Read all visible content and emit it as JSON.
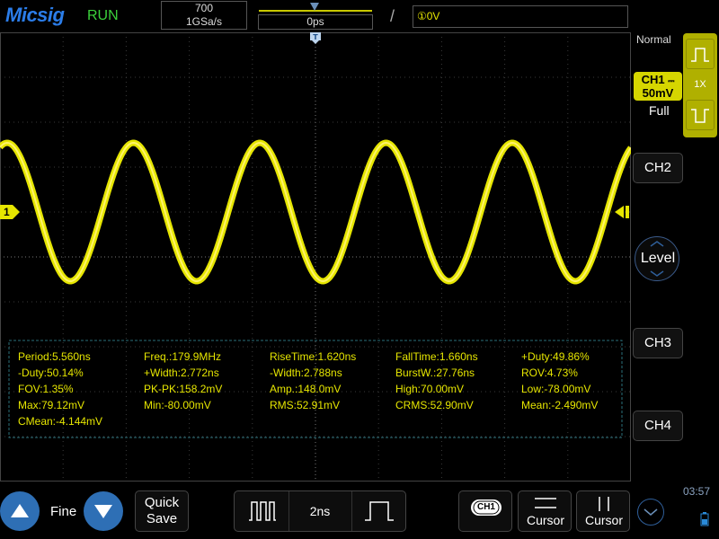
{
  "brand": {
    "logo": "Micsig",
    "run_state": "RUN"
  },
  "acquisition": {
    "memory_depth": "700",
    "sample_rate": "1GSa/s"
  },
  "timebase": {
    "offset": "0ps",
    "scale": "2ns"
  },
  "trigger": {
    "slope_symbol": "/",
    "source_level": "①0V"
  },
  "right_panel": {
    "trigger_mode": "Normal",
    "ch1_label": "CH1",
    "ch1_coupling_symbol": "⎓",
    "ch1_scale": "50mV",
    "ch1_probe": "1X",
    "bandwidth": "Full",
    "ch2": "CH2",
    "level": "Level",
    "ch3": "CH3",
    "ch4": "CH4"
  },
  "markers": {
    "ch1_ground": "1"
  },
  "measurements": [
    [
      "Period:5.560ns",
      "Freq.:179.9MHz",
      "RiseTime:1.620ns",
      "FallTime:1.660ns",
      "+Duty:49.86%"
    ],
    [
      "-Duty:50.14%",
      "+Width:2.772ns",
      "-Width:2.788ns",
      "BurstW.:27.76ns",
      "ROV:4.73%"
    ],
    [
      "FOV:1.35%",
      "PK-PK:158.2mV",
      "Amp.:148.0mV",
      "High:70.00mV",
      "Low:-78.00mV"
    ],
    [
      "Max:79.12mV",
      "Min:-80.00mV",
      "RMS:52.91mV",
      "CRMS:52.90mV",
      "Mean:-2.490mV"
    ],
    [
      "CMean:-4.144mV"
    ]
  ],
  "bottom_bar": {
    "fine": "Fine",
    "quick_save_line1": "Quick",
    "quick_save_line2": "Save",
    "cursor1": "Cursor",
    "cursor2": "Cursor",
    "ch1_badge": "CH1",
    "time": "03:57"
  },
  "colors": {
    "trace": "#e6e600",
    "accent_blue": "#2e6fb5",
    "run_green": "#3bd13b"
  }
}
